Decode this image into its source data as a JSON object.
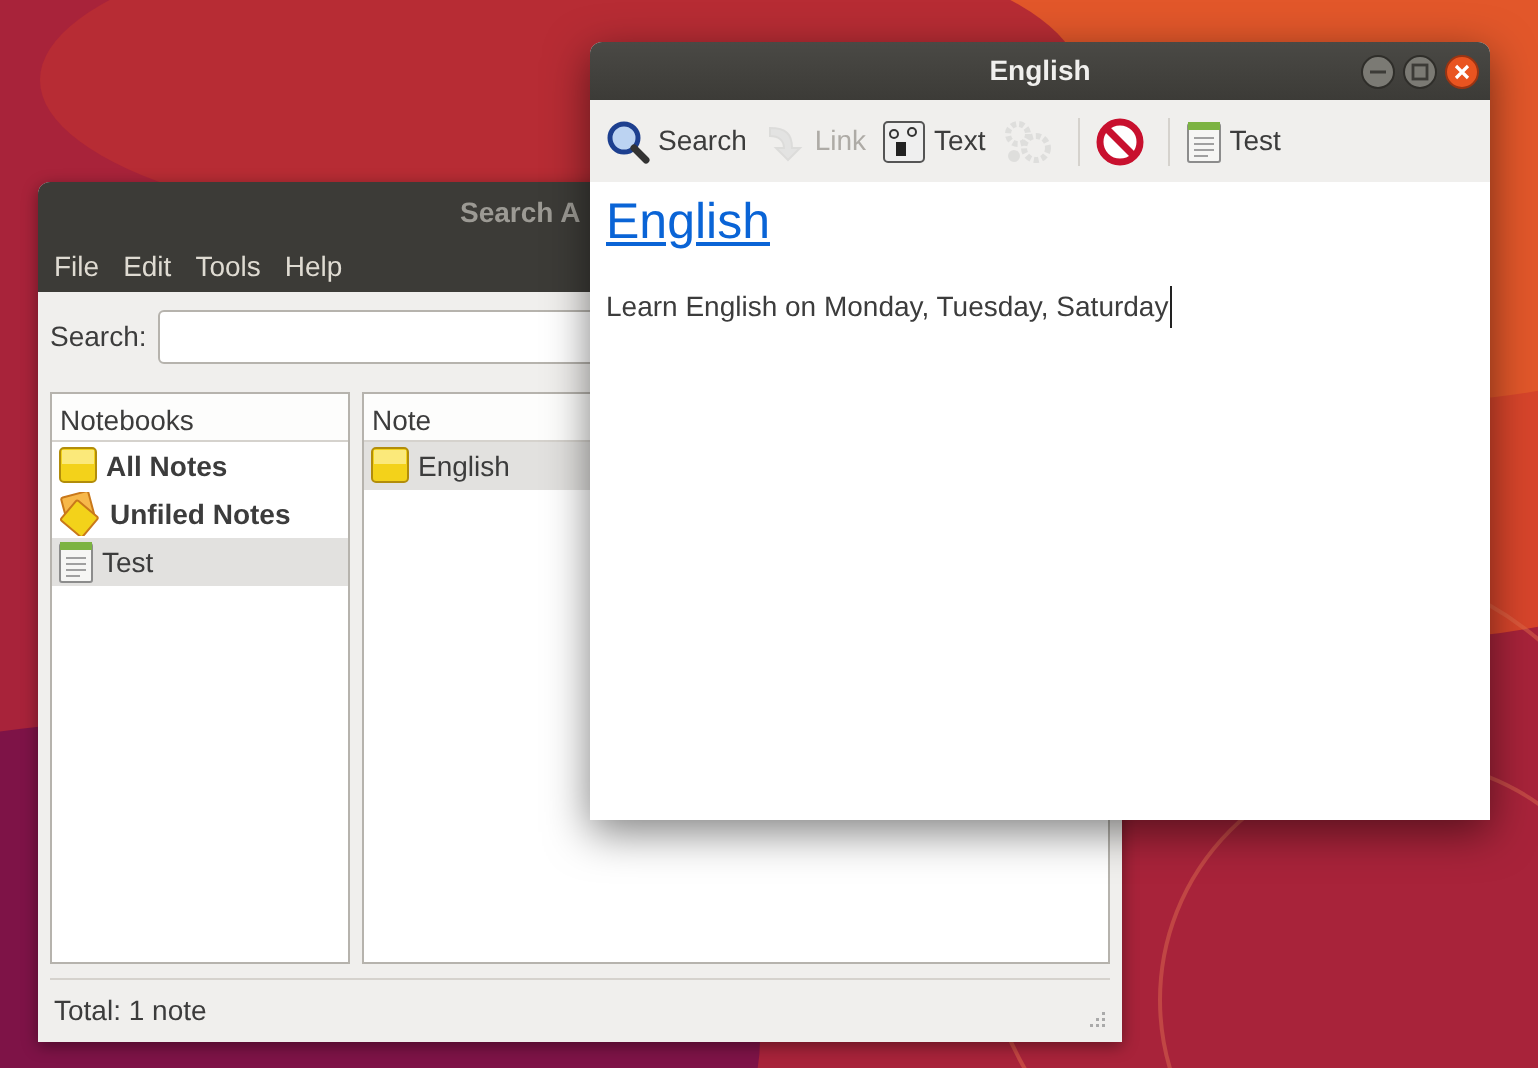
{
  "search_window": {
    "title": "Search A",
    "menu": [
      "File",
      "Edit",
      "Tools",
      "Help"
    ],
    "search_label": "Search:",
    "notebooks_header": "Notebooks",
    "notebooks": [
      {
        "label": "All Notes",
        "kind": "special",
        "selected": false
      },
      {
        "label": "Unfiled Notes",
        "kind": "unfiled",
        "selected": false
      },
      {
        "label": "Test",
        "kind": "notebook",
        "selected": true
      }
    ],
    "notes_header": "Note",
    "notes": [
      {
        "title": "English",
        "selected": true
      }
    ],
    "status_bar": "Total: 1 note"
  },
  "note_window": {
    "title": "English",
    "toolbar": [
      {
        "kind": "button",
        "label": "Search",
        "disabled": false
      },
      {
        "kind": "button",
        "label": "Link",
        "disabled": true
      },
      {
        "kind": "button",
        "label": "Text",
        "disabled": false
      },
      {
        "kind": "button",
        "disabled": true
      },
      {
        "kind": "separator"
      },
      {
        "kind": "button",
        "disabled": false
      },
      {
        "kind": "separator"
      },
      {
        "kind": "button",
        "label": "Test",
        "disabled": false
      }
    ],
    "note_title": "English",
    "note_body": "Learn English on Monday, Tuesday, Saturday"
  }
}
